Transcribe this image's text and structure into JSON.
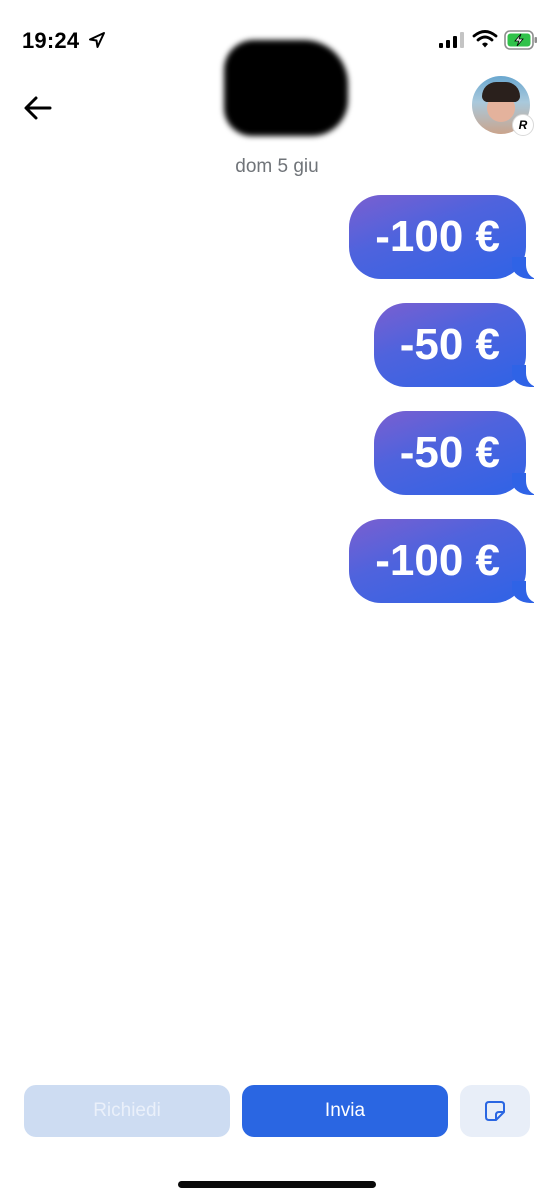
{
  "status_bar": {
    "time": "19:24",
    "icons": [
      "location-arrow-icon",
      "cellular-signal-icon",
      "wifi-icon",
      "battery-charging-icon"
    ],
    "battery_color": "#30c24a"
  },
  "header": {
    "back_icon": "arrow-left-icon",
    "contact_name": "",
    "avatar_badge": "R"
  },
  "conversation": {
    "date": "dom 5 giu",
    "messages": [
      {
        "amount": "-100 €"
      },
      {
        "amount": "-50 €"
      },
      {
        "amount": "-50 €"
      },
      {
        "amount": "-100 €"
      }
    ]
  },
  "actions": {
    "request_label": "Richiedi",
    "send_label": "Invia",
    "sticker_icon": "sticker-icon"
  },
  "colors": {
    "accent": "#2a66e2",
    "bubble_gradient_start": "#7a5fd0",
    "bubble_gradient_end": "#2f63e6",
    "request_disabled": "#cddcf2"
  }
}
